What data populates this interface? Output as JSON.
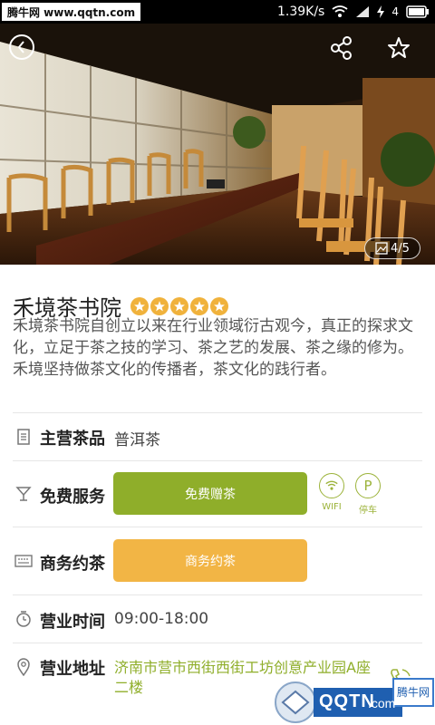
{
  "status_bar": {
    "watermark": "腾牛网 www.qqtn.com",
    "speed": "1.39K/s",
    "signal_label": "4"
  },
  "hero": {
    "photo_counter": "4/5"
  },
  "shop": {
    "name": "禾境茶书院",
    "rating_stars": 5,
    "description": "禾境茶书院自创立以来在行业领域衍古观今，真正的探求文化，立足于茶之技的学习、茶之艺的发展、茶之缘的修为。禾境坚持做茶文化的传播者，茶文化的践行者。"
  },
  "info": {
    "main_tea": {
      "label": "主营茶品",
      "value": "普洱茶"
    },
    "free_service": {
      "label": "免费服务",
      "button": "免费赠茶",
      "wifi_label": "WIFI",
      "parking_symbol": "P",
      "parking_label": "停车"
    },
    "business_tea": {
      "label": "商务约茶",
      "button": "商务约茶"
    },
    "hours": {
      "label": "营业时间",
      "value": "09:00-18:00"
    },
    "address": {
      "label": "营业地址",
      "value": "济南市营市西街西街工坊创意产业园A座二楼"
    }
  },
  "watermark_br": {
    "text": "QQTN",
    "suffix": ".com",
    "badge": "腾牛网"
  },
  "colors": {
    "accent_green": "#8fae2a",
    "accent_orange": "#f2b545",
    "star": "#f0b23c"
  }
}
